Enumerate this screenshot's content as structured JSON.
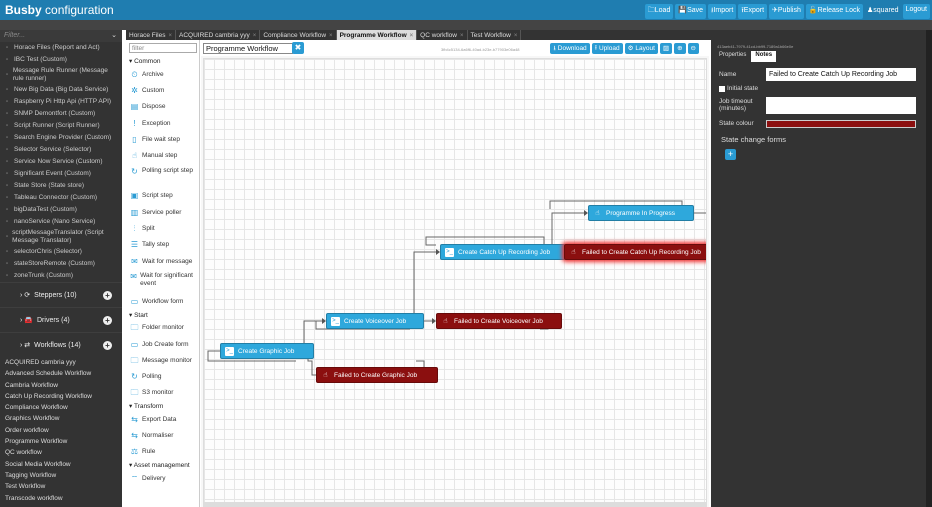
{
  "app": {
    "brand_bold": "Busby",
    "brand_rest": " configuration"
  },
  "toolbar": [
    "Load",
    "Save",
    "Import",
    "Export",
    "Publish",
    "Release Lock"
  ],
  "toolbar_icons": [
    "folder-icon",
    "save-icon",
    "import-icon",
    "export-icon",
    "publish-icon",
    "unlock-icon"
  ],
  "user": "squared",
  "logout": "Logout",
  "sidebar": {
    "filter_placeholder": "Filter...",
    "services": [
      "Horace Files (Report and Act)",
      "IBC Test (Custom)",
      "Message Rule Runner (Message rule runner)",
      "New Big Data (Big Data Service)",
      "Raspberry Pi Http Api (HTTP API)",
      "SNMP Demontfort (Custom)",
      "Script Runner (Script Runner)",
      "Search Engine Provider (Custom)",
      "Selector Service (Selector)",
      "Service Now Service (Custom)",
      "Significant Event (Custom)",
      "State Store (State store)",
      "Tableau Connector (Custom)",
      "bigDataTest (Custom)",
      "nanoService (Nano Service)",
      "scriptMessageTranslator (Script Message Translator)",
      "selectorChris (Selector)",
      "stateStoreRemote (Custom)",
      "zoneTrunk (Custom)"
    ],
    "groups": [
      {
        "label": "Steppers (10)",
        "icon": "stepper-icon"
      },
      {
        "label": "Drivers (4)",
        "icon": "car-icon"
      },
      {
        "label": "Workflows (14)",
        "icon": "workflow-icon"
      }
    ],
    "workflows": [
      "ACQUIRED cambria yyy",
      "Advanced Schedule Workflow",
      "Cambria Workflow",
      "Catch Up Recording Workflow",
      "Compliance Workflow",
      "Graphics Workflow",
      "Order workflow",
      "Programme Workflow",
      "QC workflow",
      "Social Media Workflow",
      "Tagging Workflow",
      "Test Workflow",
      "Transcode workflow"
    ]
  },
  "tabs": [
    {
      "label": "Horace Files",
      "active": false
    },
    {
      "label": "ACQUIRED cambria yyy",
      "active": false
    },
    {
      "label": "Compliance Workflow",
      "active": false
    },
    {
      "label": "Programme Workflow",
      "active": true
    },
    {
      "label": "QC workflow",
      "active": false
    },
    {
      "label": "Test Workflow",
      "active": false
    }
  ],
  "palette": {
    "filter_placeholder": "filter",
    "sections": [
      {
        "title": "Common",
        "items": [
          {
            "label": "Archive",
            "icon": "clock-icon"
          },
          {
            "label": "Custom",
            "icon": "puzzle-icon"
          },
          {
            "label": "Dispose",
            "icon": "document-icon"
          },
          {
            "label": "Exception",
            "icon": "exclamation-icon"
          },
          {
            "label": "File wait step",
            "icon": "file-icon"
          },
          {
            "label": "Manual step",
            "icon": "hand-icon"
          },
          {
            "label": "Polling script step",
            "icon": "refresh-icon"
          },
          {
            "label": "Script step",
            "icon": "terminal-icon"
          },
          {
            "label": "Service poller",
            "icon": "chart-icon"
          },
          {
            "label": "Split",
            "icon": "split-icon"
          },
          {
            "label": "Tally step",
            "icon": "tally-icon"
          },
          {
            "label": "Wait for message",
            "icon": "envelope-icon"
          },
          {
            "label": "Wait for significant event",
            "icon": "envelope-icon"
          },
          {
            "label": "Workflow form",
            "icon": "form-icon"
          }
        ]
      },
      {
        "title": "Start",
        "items": [
          {
            "label": "Folder monitor",
            "icon": "folder-icon"
          },
          {
            "label": "Job Create form",
            "icon": "form-icon"
          },
          {
            "label": "Message monitor",
            "icon": "folder-icon"
          },
          {
            "label": "Polling",
            "icon": "refresh-icon"
          },
          {
            "label": "S3 monitor",
            "icon": "folder-icon"
          }
        ]
      },
      {
        "title": "Transform",
        "items": [
          {
            "label": "Export Data",
            "icon": "transfer-icon"
          },
          {
            "label": "Normaliser",
            "icon": "transfer-icon"
          },
          {
            "label": "Rule",
            "icon": "rule-icon"
          }
        ]
      },
      {
        "title": "Asset management",
        "items": [
          {
            "label": "Delivery",
            "icon": "delivery-icon"
          }
        ]
      }
    ]
  },
  "canvas": {
    "workflow_name": "Programme Workflow",
    "workflow_id": "3fb4c5134-6a6f6-40ad-b23e-b77903e06a48",
    "buttons": [
      {
        "label": "Download",
        "icon": "download-icon"
      },
      {
        "label": "Upload",
        "icon": "upload-icon"
      },
      {
        "label": "Layout",
        "icon": "gear-icon"
      },
      {
        "label": "",
        "icon": "image-icon"
      },
      {
        "label": "",
        "icon": "zoom-in-icon"
      },
      {
        "label": "",
        "icon": "zoom-out-icon"
      }
    ],
    "nodes": [
      {
        "label": "Create Graphic Job",
        "type": "blue",
        "icon": "script-icon"
      },
      {
        "label": "Failed to Create Graphic Job",
        "type": "red",
        "icon": "hand-icon"
      },
      {
        "label": "Create Voiceover Job",
        "type": "blue",
        "icon": "script-icon"
      },
      {
        "label": "Failed to Create Voiceover Job",
        "type": "red",
        "icon": "hand-icon"
      },
      {
        "label": "Create Catch Up Recording Job",
        "type": "blue",
        "icon": "script-icon"
      },
      {
        "label": "Failed to Create Catch Up Recording Job",
        "type": "red-selected",
        "icon": "hand-icon"
      },
      {
        "label": "Programme In Progress",
        "type": "blue",
        "icon": "hand-icon"
      }
    ]
  },
  "properties": {
    "state_id": "413aeb41-7979-41cd-bb99-7189a1b66e0e",
    "tabs": [
      {
        "label": "Properties",
        "active": false
      },
      {
        "label": "Notes",
        "active": true
      }
    ],
    "name_label": "Name",
    "name_value": "Failed to Create Catch Up Recording Job",
    "initial_state_label": "Initial state",
    "initial_state_checked": false,
    "timeout_label": "Job timeout (minutes)",
    "timeout_value": "",
    "colour_label": "State colour",
    "colour_value": "#8b0f0f",
    "forms_label": "State change forms"
  }
}
